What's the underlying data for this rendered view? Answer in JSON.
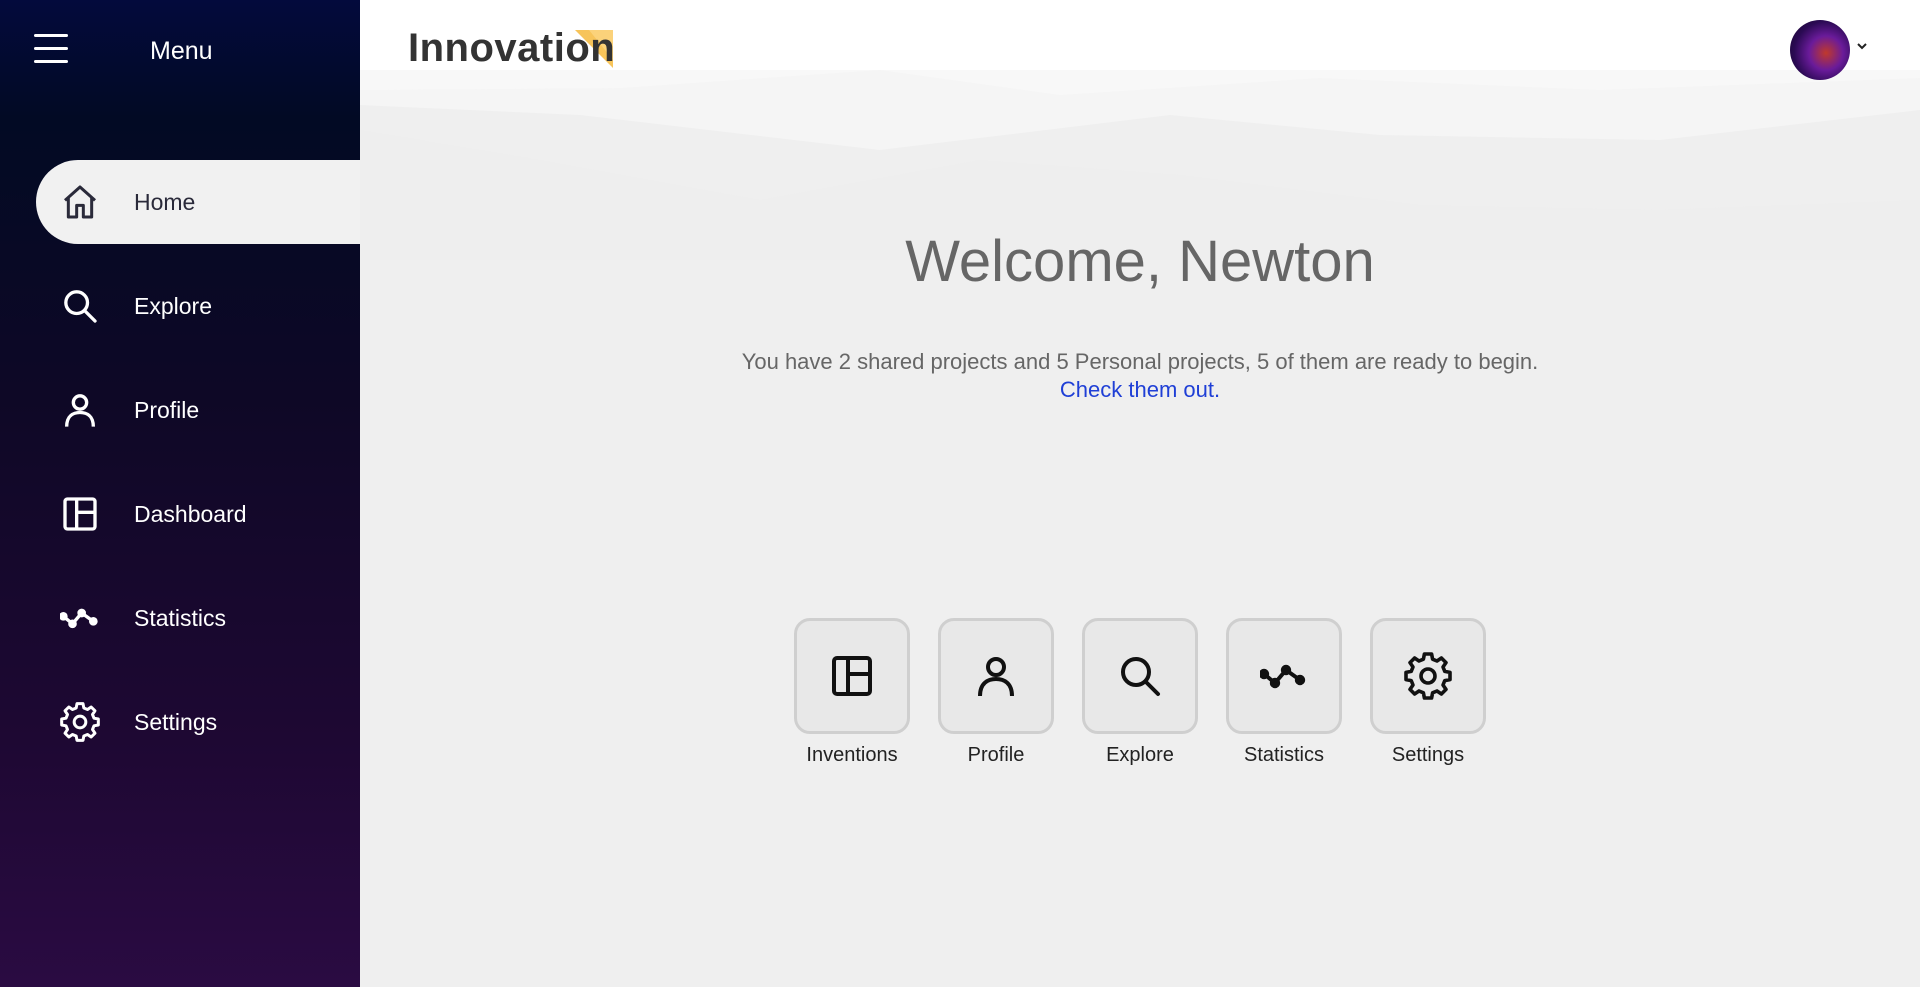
{
  "sidebar": {
    "menu_title": "Menu",
    "items": [
      {
        "label": "Home",
        "icon": "home-icon",
        "active": true
      },
      {
        "label": "Explore",
        "icon": "search-icon",
        "active": false
      },
      {
        "label": "Profile",
        "icon": "user-icon",
        "active": false
      },
      {
        "label": "Dashboard",
        "icon": "dashboard-icon",
        "active": false
      },
      {
        "label": "Statistics",
        "icon": "stats-icon",
        "active": false
      },
      {
        "label": "Settings",
        "icon": "gear-icon",
        "active": false
      }
    ]
  },
  "header": {
    "logo_text": "Innovation",
    "logo_accent_color": "#f7c45a"
  },
  "main": {
    "welcome": "Welcome, Newton",
    "summary": "You have 2 shared projects and 5 Personal projects, 5 of them are ready to begin.",
    "link": "Check them out.",
    "tiles": [
      {
        "label": "Inventions",
        "icon": "dashboard-icon"
      },
      {
        "label": "Profile",
        "icon": "user-icon"
      },
      {
        "label": "Explore",
        "icon": "search-icon"
      },
      {
        "label": "Statistics",
        "icon": "stats-icon"
      },
      {
        "label": "Settings",
        "icon": "gear-icon"
      }
    ]
  },
  "colors": {
    "sidebar_top": "#030a3c",
    "sidebar_bottom": "#2a0b42",
    "link": "#1f3fd6",
    "text": "#666666"
  }
}
